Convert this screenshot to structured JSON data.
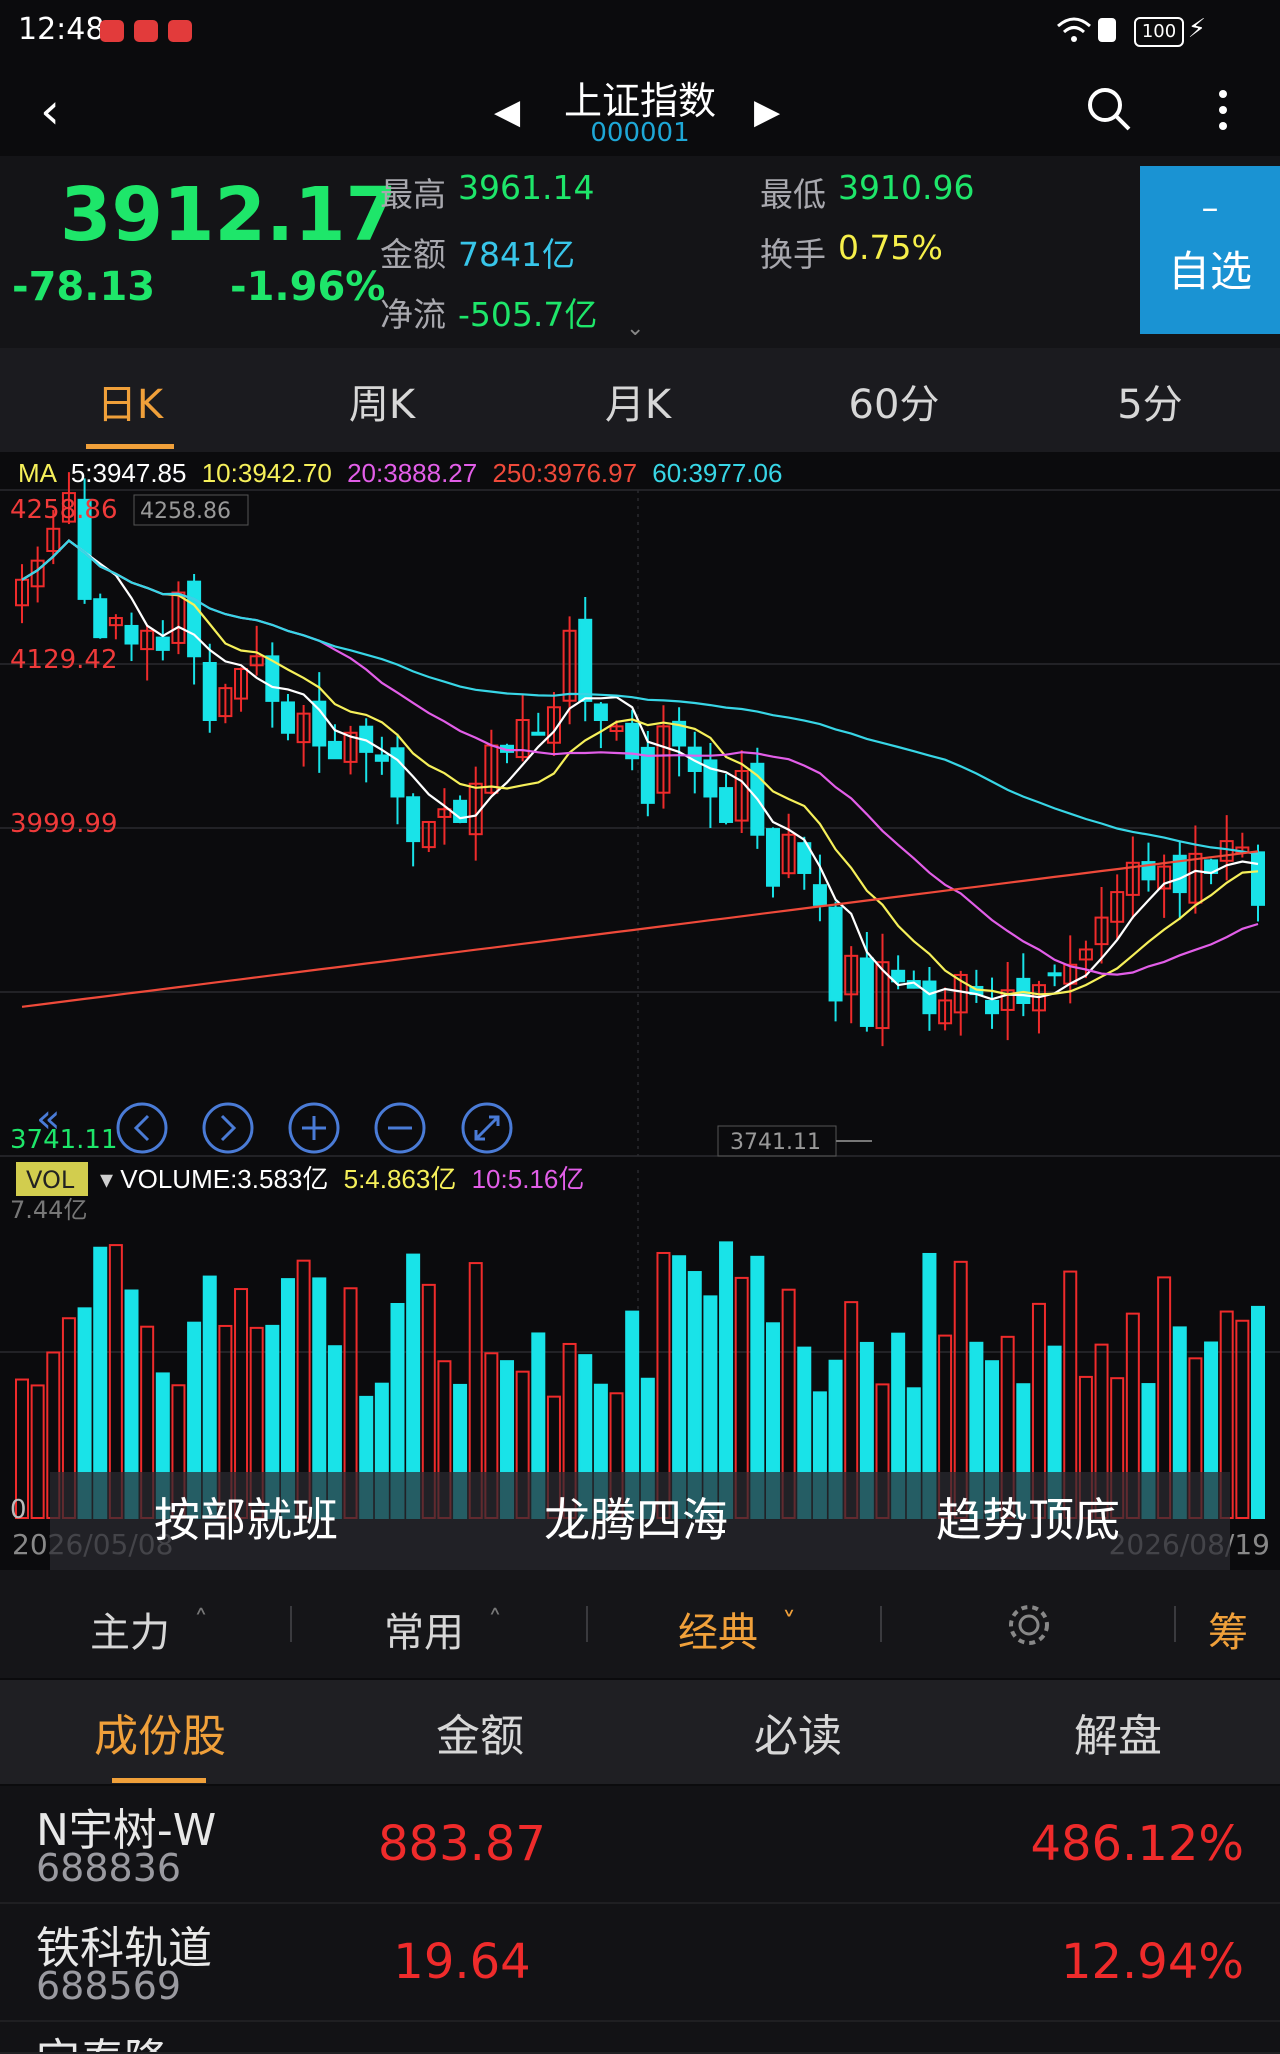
{
  "status_bar": {
    "time": "12:48",
    "battery": "100"
  },
  "nav": {
    "title": "上证指数",
    "code": "000001",
    "prev_arrow": "◀",
    "next_arrow": "▶",
    "back_icon": "‹",
    "search_icon": "search-icon",
    "more_icon": "more-icon"
  },
  "quote": {
    "price": "3912.17",
    "change": "-78.13",
    "change_pct": "-1.96%",
    "high_label": "最高",
    "high": "3961.14",
    "low_label": "最低",
    "low": "3910.96",
    "amount_label": "金额",
    "amount": "7841亿",
    "turnover_label": "换手",
    "turnover": "0.75%",
    "netflow_label": "净流",
    "netflow": "-505.7亿",
    "watch_minus": "–",
    "watch_label": "自选"
  },
  "period_tabs": [
    "日K",
    "周K",
    "月K",
    "60分",
    "5分"
  ],
  "chart_header": {
    "ma_label": "MA",
    "ma5": "5:3947.85",
    "ma10": "10:3942.70",
    "ma20": "20:3888.27",
    "ma250": "250:3976.97",
    "ma60": "60:3977.06",
    "y_top": "4258.86",
    "y_top_tag": "4258.86",
    "y_mid1": "4129.42",
    "y_mid2": "3999.99",
    "y_low": "3741.11",
    "low_tag": "3741.11",
    "vol_tag": "VOL",
    "volume": "VOLUME:3.583亿",
    "vol5": "5:4.863亿",
    "vol10": "10:5.16亿",
    "vol_top": "7.44亿",
    "vol_zero": "0",
    "x_start": "2026/05/08",
    "x_end": "2026/08/19"
  },
  "banner": {
    "items": [
      "按部就班",
      "龙腾四海",
      "趋势顶底"
    ]
  },
  "toolbar": {
    "main": "主力",
    "common": "常用",
    "classic": "经典",
    "chip": "筹"
  },
  "list_tabs": [
    "成份股",
    "金额",
    "必读",
    "解盘"
  ],
  "stocks": [
    {
      "name": "N宇树-W",
      "code": "688836",
      "price": "883.87",
      "pct": "486.12%"
    },
    {
      "name": "铁科轨道",
      "code": "688569",
      "price": "19.64",
      "pct": "12.94%"
    },
    {
      "name": "宝泰隆",
      "code": "",
      "price": "",
      "pct": ""
    }
  ],
  "colors": {
    "up": "#ef2b2b",
    "down": "#1ee66a",
    "ma5": "#ffffff",
    "ma10": "#f6f05a",
    "ma20": "#e25ee8",
    "ma60": "#38d6e6",
    "ma250": "#ef4a3a",
    "accent": "#f0a03a",
    "candle_down": "#19e3e8"
  },
  "chart_data": {
    "type": "candlestick",
    "ylim": [
      3741.11,
      4258.86
    ],
    "closes": [
      4190,
      4205,
      4230,
      4258,
      4175,
      4145,
      4160,
      4140,
      4150,
      4135,
      4180,
      4130,
      4080,
      4105,
      4120,
      4130,
      4095,
      4070,
      4085,
      4060,
      4050,
      4070,
      4055,
      4048,
      4020,
      3985,
      4000,
      4010,
      4000,
      4030,
      4060,
      4055,
      4080,
      4070,
      4090,
      4150,
      4095,
      4080,
      4075,
      4050,
      4015,
      4075,
      4060,
      4040,
      4020,
      4000,
      4040,
      3990,
      3950,
      3990,
      3960,
      3935,
      3860,
      3895,
      3840,
      3890,
      3875,
      3870,
      3850,
      3860,
      3880,
      3865,
      3850,
      3868,
      3858,
      3872,
      3880,
      3888,
      3900,
      3925,
      3945,
      3968,
      3955,
      3965,
      3945,
      3975,
      3960,
      3985,
      3980,
      3935
    ]
  }
}
